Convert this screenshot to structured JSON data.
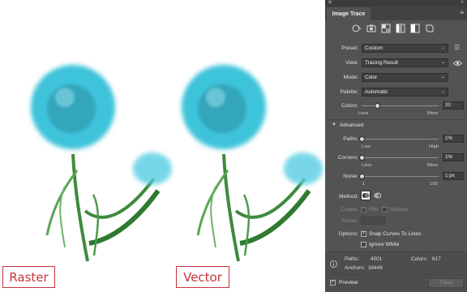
{
  "captions": {
    "raster": "Raster",
    "vector": "Vector"
  },
  "panel": {
    "title": "Image Trace",
    "preset": {
      "label": "Preset:",
      "value": "Custom"
    },
    "view": {
      "label": "View:",
      "value": "Tracing Result"
    },
    "mode": {
      "label": "Mode:",
      "value": "Color"
    },
    "palette": {
      "label": "Palette:",
      "value": "Automatic"
    },
    "colors": {
      "label": "Colors:",
      "value": "20",
      "min_label": "Less",
      "max_label": "More",
      "level": 0.2
    },
    "advanced_label": "Advanced",
    "paths": {
      "label": "Paths:",
      "value": "1%",
      "min_label": "Low",
      "max_label": "High",
      "level": 0.01
    },
    "corners": {
      "label": "Corners:",
      "value": "1%",
      "min_label": "Less",
      "max_label": "More",
      "level": 0.01
    },
    "noise": {
      "label": "Noise:",
      "value": "1 px",
      "min_label": "1",
      "max_label": "100",
      "level": 0.01
    },
    "method_label": "Method:",
    "create": {
      "label": "Create:",
      "fills": "Fills",
      "strokes": "Strokes"
    },
    "stroke": {
      "label": "Stroke:"
    },
    "options": {
      "label": "Options:",
      "snap_curves": "Snap Curves To Lines",
      "ignore_white": "Ignore White"
    },
    "stats": {
      "paths_label": "Paths:",
      "paths_value": "4501",
      "colors_label": "Colors:",
      "colors_value": "617",
      "anchors_label": "Anchors:",
      "anchors_value": "34448"
    },
    "preview_label": "Preview",
    "trace_button": "Trace"
  },
  "colors": {
    "panel_bg": "#535353",
    "flower": "#3ec3da",
    "stem": "#3f8a3c",
    "caption_border": "#c6343c"
  }
}
